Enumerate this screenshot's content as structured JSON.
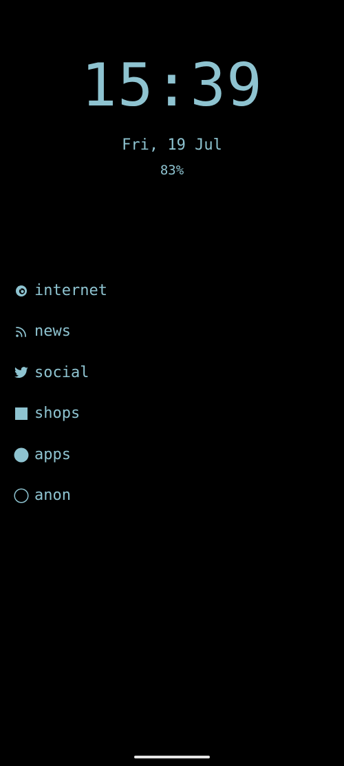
{
  "clock": {
    "time": "15:39",
    "date": "Fri, 19 Jul",
    "battery": "83%"
  },
  "menu": {
    "items": [
      {
        "label": "internet",
        "icon": "firefox-icon"
      },
      {
        "label": "news",
        "icon": "rss-icon"
      },
      {
        "label": "social",
        "icon": "twitter-bird-icon"
      },
      {
        "label": "shops",
        "icon": "square-icon"
      },
      {
        "label": "apps",
        "icon": "filled-circle-icon"
      },
      {
        "label": "anon",
        "icon": "outline-circle-icon"
      }
    ]
  },
  "theme": {
    "background": "#000000",
    "accent": "#8ec3d0",
    "home_indicator": "#e6e6e6"
  }
}
